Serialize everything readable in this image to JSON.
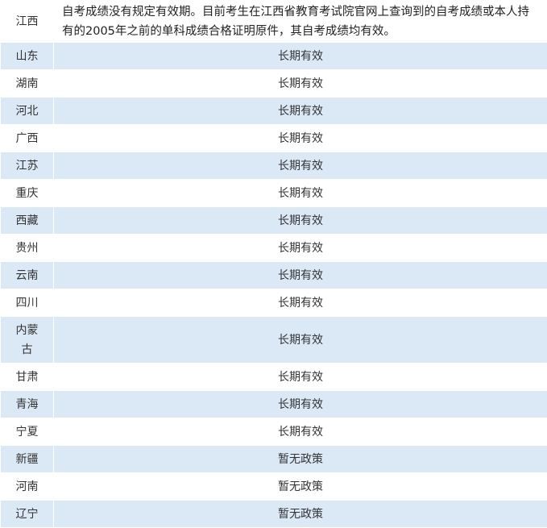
{
  "rows": [
    {
      "province": "江西",
      "policy": "自考成绩没有规定有效期。目前考生在江西省教育考试院官网上查询到的自考成绩或本人持有的2005年之前的单科成绩合格证明原件，其自考成绩均有效。"
    },
    {
      "province": "山东",
      "policy": "长期有效"
    },
    {
      "province": "湖南",
      "policy": "长期有效"
    },
    {
      "province": "河北",
      "policy": "长期有效"
    },
    {
      "province": "广西",
      "policy": "长期有效"
    },
    {
      "province": "江苏",
      "policy": "长期有效"
    },
    {
      "province": "重庆",
      "policy": "长期有效"
    },
    {
      "province": "西藏",
      "policy": "长期有效"
    },
    {
      "province": "贵州",
      "policy": "长期有效"
    },
    {
      "province": "云南",
      "policy": "长期有效"
    },
    {
      "province": "四川",
      "policy": "长期有效"
    },
    {
      "province": "内蒙古",
      "policy": "长期有效"
    },
    {
      "province": "甘肃",
      "policy": "长期有效"
    },
    {
      "province": "青海",
      "policy": "长期有效"
    },
    {
      "province": "宁夏",
      "policy": "长期有效"
    },
    {
      "province": "新疆",
      "policy": "暂无政策"
    },
    {
      "province": "河南",
      "policy": "暂无政策"
    },
    {
      "province": "辽宁",
      "policy": "暂无政策"
    }
  ],
  "colors": {
    "band": "#dbe8f5",
    "text": "#333333"
  }
}
